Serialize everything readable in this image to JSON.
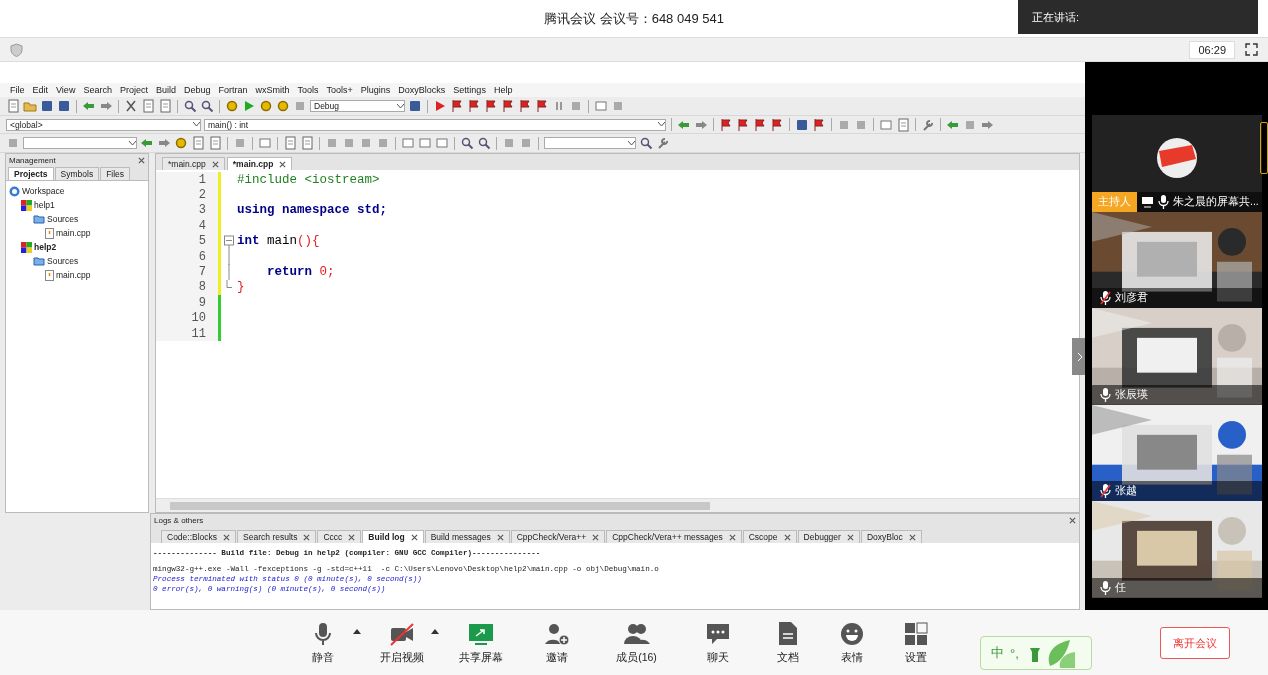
{
  "meeting": {
    "title": "腾讯会议 会议号：648 049 541",
    "speaking_label": "正在讲话:",
    "timer": "06:29"
  },
  "ide": {
    "menu": [
      "File",
      "Edit",
      "View",
      "Search",
      "Project",
      "Build",
      "Debug",
      "Fortran",
      "wxSmith",
      "Tools",
      "Tools+",
      "Plugins",
      "DoxyBlocks",
      "Settings",
      "Help"
    ],
    "build_target": "Debug",
    "scope": "<global>",
    "function": "main() : int",
    "management": {
      "title": "Management",
      "tabs": [
        {
          "label": "Projects",
          "selected": true
        },
        {
          "label": "Symbols",
          "selected": false
        },
        {
          "label": "Files",
          "selected": false
        }
      ],
      "tree": [
        {
          "label": "Workspace",
          "kind": "workspace",
          "children": [
            {
              "label": "help1",
              "kind": "project",
              "active": false,
              "children": [
                {
                  "label": "Sources",
                  "kind": "folder",
                  "children": [
                    {
                      "label": "main.cpp",
                      "kind": "file"
                    }
                  ]
                }
              ]
            },
            {
              "label": "help2",
              "kind": "project",
              "active": true,
              "children": [
                {
                  "label": "Sources",
                  "kind": "folder",
                  "children": [
                    {
                      "label": "main.cpp",
                      "kind": "file"
                    }
                  ]
                }
              ]
            }
          ]
        }
      ]
    },
    "editor": {
      "tabs": [
        {
          "label": "*main.cpp",
          "selected": false
        },
        {
          "label": "*main.cpp",
          "selected": true
        }
      ],
      "lines": [
        {
          "number": "1",
          "saved": false,
          "kind": "plain",
          "tokens": [
            {
              "text": "#include <iostream>",
              "kind": "preprocessor"
            }
          ]
        },
        {
          "number": "2",
          "saved": false,
          "kind": "plain"
        },
        {
          "number": "3",
          "saved": false,
          "kind": "plain",
          "tokens": [
            {
              "text": "using namespace std;",
              "kind": "keyword"
            }
          ]
        },
        {
          "number": "4",
          "saved": false,
          "kind": "plain"
        },
        {
          "number": "5",
          "saved": false,
          "kind": "fold-start",
          "tokens": [
            {
              "text": "int",
              "kind": "keyword"
            },
            {
              "text": " main",
              "kind": "plain"
            },
            {
              "text": "(){",
              "kind": "operator"
            }
          ]
        },
        {
          "number": "6",
          "saved": false,
          "kind": "fold-body"
        },
        {
          "number": "7",
          "saved": false,
          "kind": "fold-body",
          "tokens": [
            {
              "text": "    return",
              "kind": "keyword"
            },
            {
              "text": " 0;",
              "kind": "operator"
            }
          ]
        },
        {
          "number": "8",
          "saved": false,
          "kind": "fold-end",
          "tokens": [
            {
              "text": "}",
              "kind": "operator"
            }
          ]
        },
        {
          "number": "9",
          "saved": true,
          "kind": "plain"
        },
        {
          "number": "10",
          "saved": true,
          "kind": "plain"
        },
        {
          "number": "11",
          "saved": true,
          "kind": "plain"
        }
      ]
    },
    "logs": {
      "title": "Logs & others",
      "tabs": [
        {
          "label": "Code::Blocks",
          "selected": false
        },
        {
          "label": "Search results",
          "selected": false
        },
        {
          "label": "Cccc",
          "selected": false
        },
        {
          "label": "Build log",
          "selected": true
        },
        {
          "label": "Build messages",
          "selected": false
        },
        {
          "label": "CppCheck/Vera++",
          "selected": false
        },
        {
          "label": "CppCheck/Vera++ messages",
          "selected": false
        },
        {
          "label": "Cscope",
          "selected": false
        },
        {
          "label": "Debugger",
          "selected": false
        },
        {
          "label": "DoxyBloc",
          "selected": false
        }
      ],
      "lines": [
        {
          "text": "-------------- Build file: Debug in help2 (compiler: GNU GCC Compiler)---------------",
          "kind": "header"
        },
        {
          "text": "mingw32-g++.exe -Wall -fexceptions -g -std=c++11  -c C:\\Users\\Lenovo\\Desktop\\help2\\main.cpp -o obj\\Debug\\main.o",
          "kind": "command"
        },
        {
          "text": "Process terminated with status 0 (0 minute(s), 0 second(s))",
          "kind": "info"
        },
        {
          "text": "0 error(s), 0 warning(s) (0 minute(s), 0 second(s))",
          "kind": "info"
        }
      ]
    }
  },
  "participants": [
    {
      "name": "朱之晨的屏幕共...",
      "host_label": "主持人",
      "muted": false,
      "kind": "avatar"
    },
    {
      "name": "刘彦君",
      "muted": true,
      "kind": "picture"
    },
    {
      "name": "张辰瑛",
      "muted": false,
      "kind": "picture"
    },
    {
      "name": "张越",
      "muted": true,
      "kind": "picture"
    },
    {
      "name": "任",
      "muted": false,
      "kind": "picture"
    }
  ],
  "toolbar": [
    {
      "label": "静音",
      "kind": "mic",
      "dropdown": true
    },
    {
      "label": "开启视频",
      "kind": "video",
      "dropdown": true
    },
    {
      "label": "共享屏幕",
      "kind": "share",
      "dropdown": false
    },
    {
      "label": "邀请",
      "kind": "invite",
      "dropdown": false
    },
    {
      "label": "成员(16)",
      "kind": "members",
      "dropdown": false
    },
    {
      "label": "聊天",
      "kind": "chat",
      "dropdown": false
    },
    {
      "label": "文档",
      "kind": "doc",
      "dropdown": false
    },
    {
      "label": "表情",
      "kind": "emoji",
      "dropdown": false
    },
    {
      "label": "设置",
      "kind": "settings",
      "dropdown": false
    }
  ],
  "ime": {
    "mode": "中",
    "punctuation": "°,"
  },
  "leave_button": "离开会议"
}
